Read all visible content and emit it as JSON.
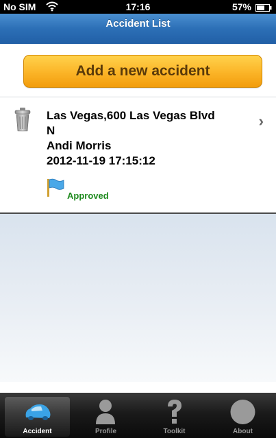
{
  "status_bar": {
    "carrier": "No SIM",
    "time": "17:16",
    "battery_percent": "57%"
  },
  "nav": {
    "title": "Accident List"
  },
  "actions": {
    "add_label": "Add a new accident"
  },
  "accidents": [
    {
      "location_line1": "Las Vegas,600 Las Vegas Blvd",
      "location_line2": "N",
      "person": "Andi Morris",
      "datetime": "2012-11-19 17:15:12",
      "status": "Approved"
    }
  ],
  "tabs": [
    {
      "label": "Accident",
      "icon": "car-icon",
      "selected": true
    },
    {
      "label": "Profile",
      "icon": "person-icon",
      "selected": false
    },
    {
      "label": "Toolkit",
      "icon": "question-icon",
      "selected": false
    },
    {
      "label": "About",
      "icon": "circle-icon",
      "selected": false
    }
  ],
  "colors": {
    "nav_blue": "#2c6fb6",
    "button_orange": "#fbb427",
    "approved_green": "#1e8a1e"
  }
}
